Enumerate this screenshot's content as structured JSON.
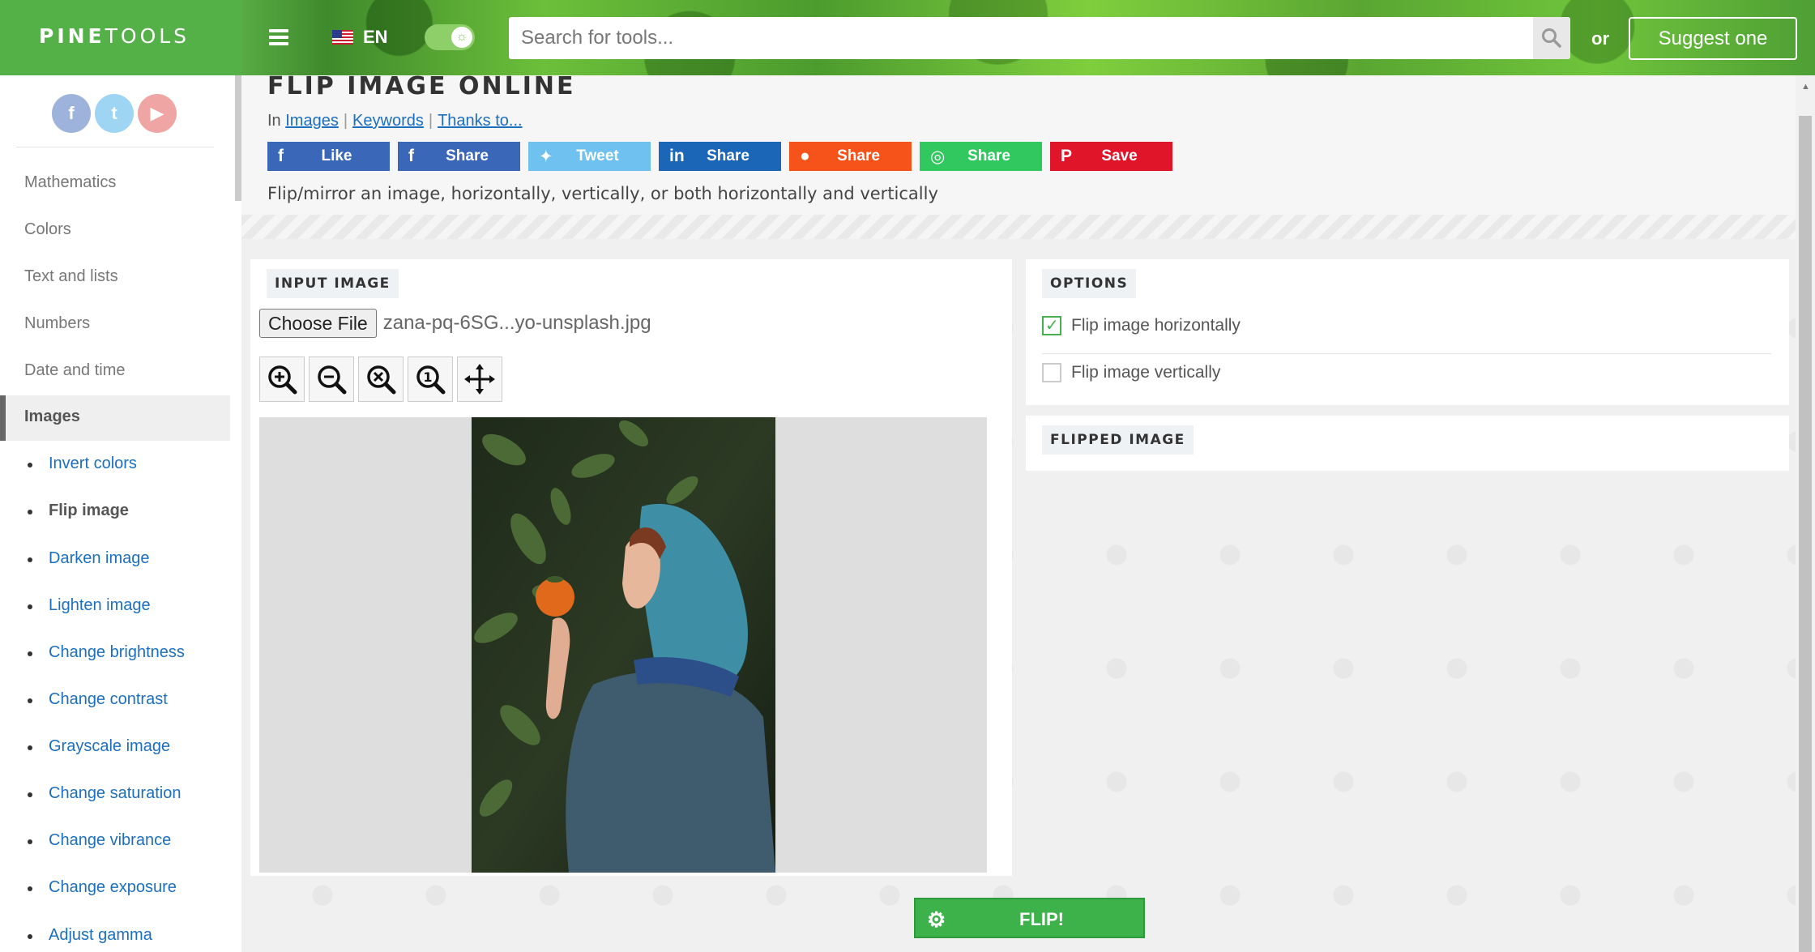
{
  "header": {
    "logo_bold": "PINE",
    "logo_thin": "TOOLS",
    "language": "EN",
    "search_placeholder": "Search for tools...",
    "or_text": "or",
    "suggest_label": "Suggest one"
  },
  "sidebar": {
    "social": [
      "f",
      "t",
      "▶"
    ],
    "categories": [
      "Mathematics",
      "Colors",
      "Text and lists",
      "Numbers",
      "Date and time"
    ],
    "active": "Images",
    "subitems": [
      "Invert colors",
      "Flip image",
      "Darken image",
      "Lighten image",
      "Change brightness",
      "Change contrast",
      "Grayscale image",
      "Change saturation",
      "Change vibrance",
      "Change exposure",
      "Adjust gamma"
    ],
    "current_subitem": "Flip image"
  },
  "page": {
    "title": "FLIP IMAGE ONLINE",
    "breadcrumb_prefix": "In",
    "breadcrumb_links": [
      "Images",
      "Keywords",
      "Thanks to..."
    ],
    "share_buttons": [
      {
        "label": "Like",
        "icon": "f",
        "color": "#3b67b9"
      },
      {
        "label": "Share",
        "icon": "f",
        "color": "#3b67b9"
      },
      {
        "label": "Tweet",
        "icon": "🐦",
        "color": "#6fc1ef"
      },
      {
        "label": "Share",
        "icon": "in",
        "color": "#1c66b8"
      },
      {
        "label": "Share",
        "icon": "●",
        "color": "#f5531a"
      },
      {
        "label": "Share",
        "icon": "◎",
        "color": "#31c85f"
      },
      {
        "label": "Save",
        "icon": "P",
        "color": "#e0152a"
      }
    ],
    "description": "Flip/mirror an image, horizontally, vertically, or both horizontally and vertically"
  },
  "input_panel": {
    "label": "INPUT IMAGE",
    "choose_file": "Choose File",
    "file_name": "zana-pq-6SG...yo-unsplash.jpg"
  },
  "options_panel": {
    "label": "OPTIONS",
    "options": [
      {
        "label": "Flip image horizontally",
        "checked": true
      },
      {
        "label": "Flip image vertically",
        "checked": false
      }
    ]
  },
  "flipped_panel": {
    "label": "FLIPPED IMAGE"
  },
  "action": {
    "flip_label": "FLIP!"
  }
}
